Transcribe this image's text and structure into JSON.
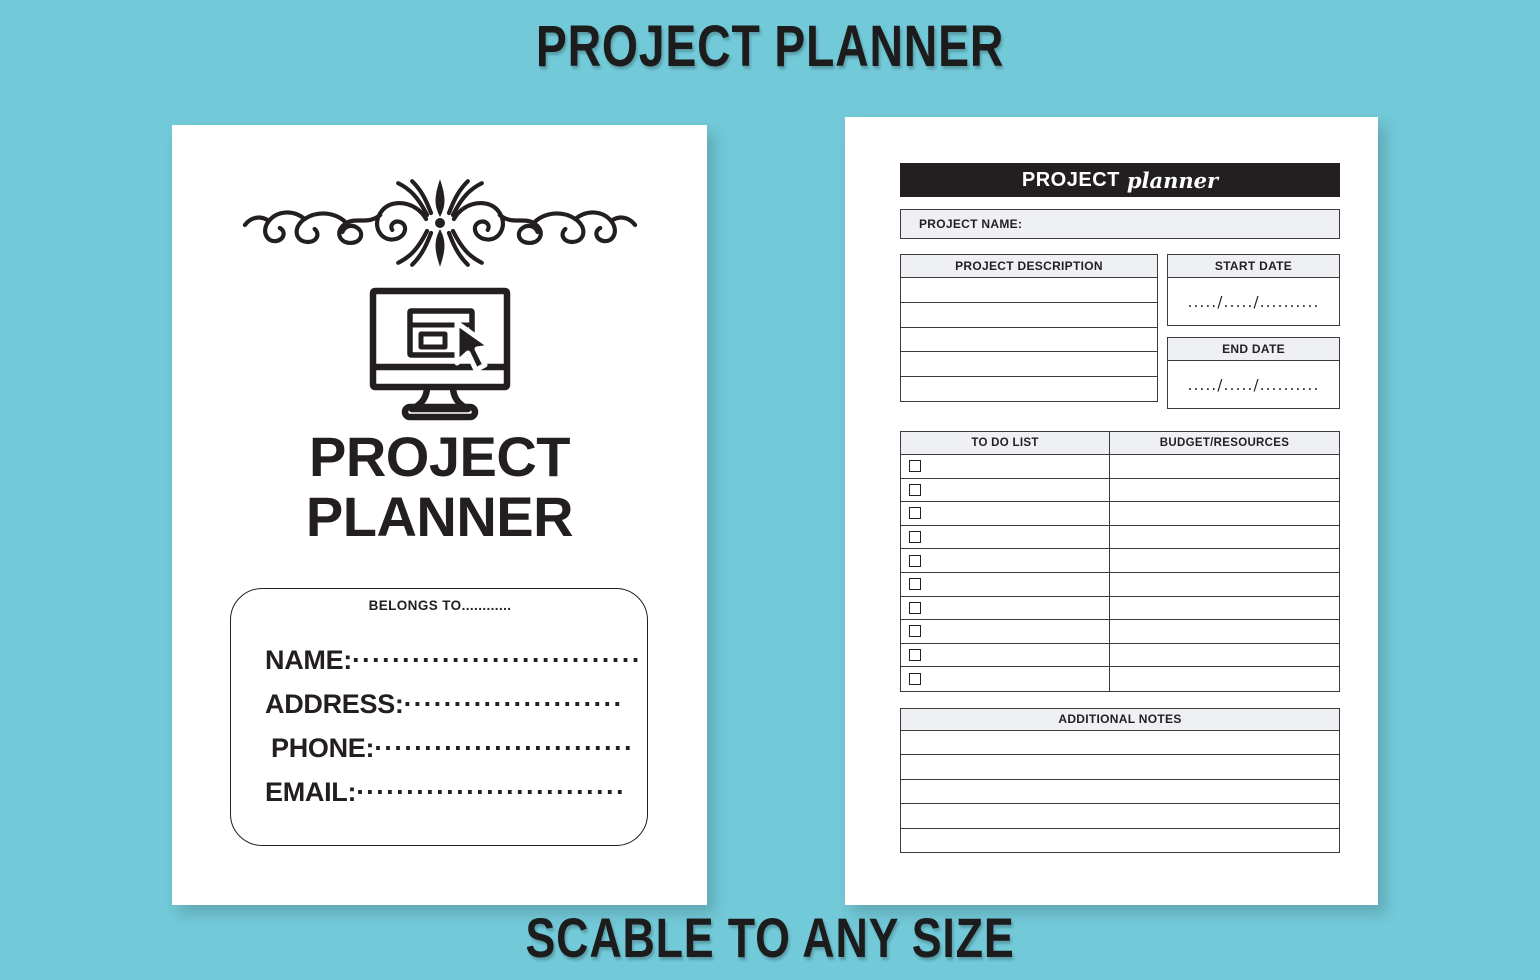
{
  "banner": {
    "top": "PROJECT PLANNER",
    "bottom": "SCABLE TO ANY SIZE"
  },
  "theme": {
    "background": "#72c9d8",
    "page": "#ffffff",
    "ink": "#231f20",
    "header_bar": "#231f20",
    "gray_fill": "#eef0f3",
    "rule": "#3b3b3b"
  },
  "cover_page": {
    "ornament": "flourish-divider-ornament",
    "icon": "monitor-cursor-icon",
    "title_line1": "PROJECT",
    "title_line2": "PLANNER",
    "belongs_to": "BELONGS TO............",
    "fields": [
      {
        "label": "NAME:",
        "dots": "·····························",
        "name": "name"
      },
      {
        "label": "ADDRESS:",
        "dots": "······················",
        "name": "address"
      },
      {
        "label": "PHONE:",
        "dots": "··························",
        "name": "phone"
      },
      {
        "label": "EMAIL:",
        "dots": "···························",
        "name": "email"
      }
    ]
  },
  "interior_page": {
    "header_bold": "PROJECT",
    "header_script": "planner",
    "project_name_label": "PROJECT NAME:",
    "description_header": "PROJECT DESCRIPTION",
    "description_rows": 5,
    "start_date_header": "START DATE",
    "start_date_value": "...../...../..........",
    "end_date_header": "END DATE",
    "end_date_value": "...../...../..........",
    "todo_header": "TO DO LIST",
    "budget_header": "BUDGET/RESOURCES",
    "todo_rows": 10,
    "notes_header": "ADDITIONAL NOTES",
    "notes_rows": 5
  }
}
